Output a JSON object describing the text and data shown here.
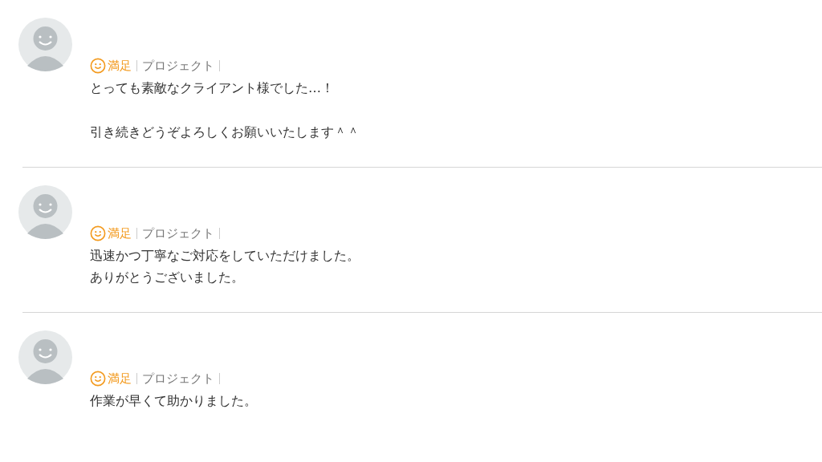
{
  "reviews": [
    {
      "rating": {
        "kind": "satisfied",
        "label": "満足"
      },
      "category": "プロジェクト",
      "paragraphs": [
        [
          "とっても素敵なクライアント様でした…！"
        ],
        [
          "引き続きどうぞよろしくお願いいたします＾＾"
        ]
      ]
    },
    {
      "rating": {
        "kind": "satisfied",
        "label": "満足"
      },
      "category": "プロジェクト",
      "paragraphs": [
        [
          "迅速かつ丁寧なご対応をしていただけました。",
          "ありがとうございました。"
        ]
      ]
    },
    {
      "rating": {
        "kind": "satisfied",
        "label": "満足"
      },
      "category": "プロジェクト",
      "paragraphs": [
        [
          "作業が早くて助かりました。"
        ]
      ]
    }
  ]
}
